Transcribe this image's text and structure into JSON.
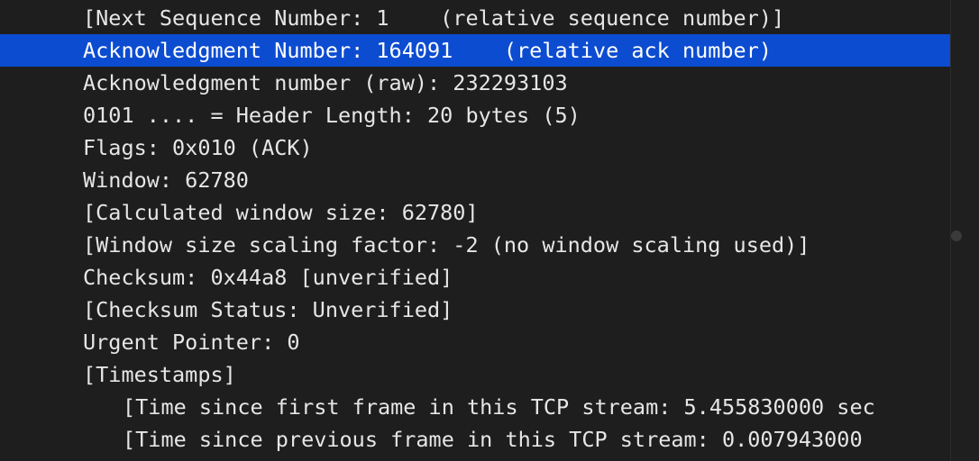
{
  "packet_details": {
    "rows": [
      {
        "text": "[Next Sequence Number: 1    (relative sequence number)]"
      },
      {
        "text": "Acknowledgment Number: 164091    (relative ack number)"
      },
      {
        "text": "Acknowledgment number (raw): 232293103"
      },
      {
        "text": "0101 .... = Header Length: 20 bytes (5)"
      },
      {
        "text": "Flags: 0x010 (ACK)",
        "toggle": "chevron-right-icon"
      },
      {
        "text": "Window: 62780"
      },
      {
        "text": "[Calculated window size: 62780]"
      },
      {
        "text": "[Window size scaling factor: -2 (no window scaling used)]"
      },
      {
        "text": "Checksum: 0x44a8 [unverified]"
      },
      {
        "text": "[Checksum Status: Unverified]"
      },
      {
        "text": "Urgent Pointer: 0"
      },
      {
        "text": "[Timestamps]",
        "toggle": "chevron-down-icon"
      },
      {
        "text": "[Time since first frame in this TCP stream: 5.455830000 sec"
      },
      {
        "text": "[Time since previous frame in this TCP stream: 0.007943000"
      }
    ],
    "selected_row": 1,
    "colors": {
      "background": "#1e1e1e",
      "text": "#e6e6e6",
      "selection": "#0c4cd1"
    }
  }
}
